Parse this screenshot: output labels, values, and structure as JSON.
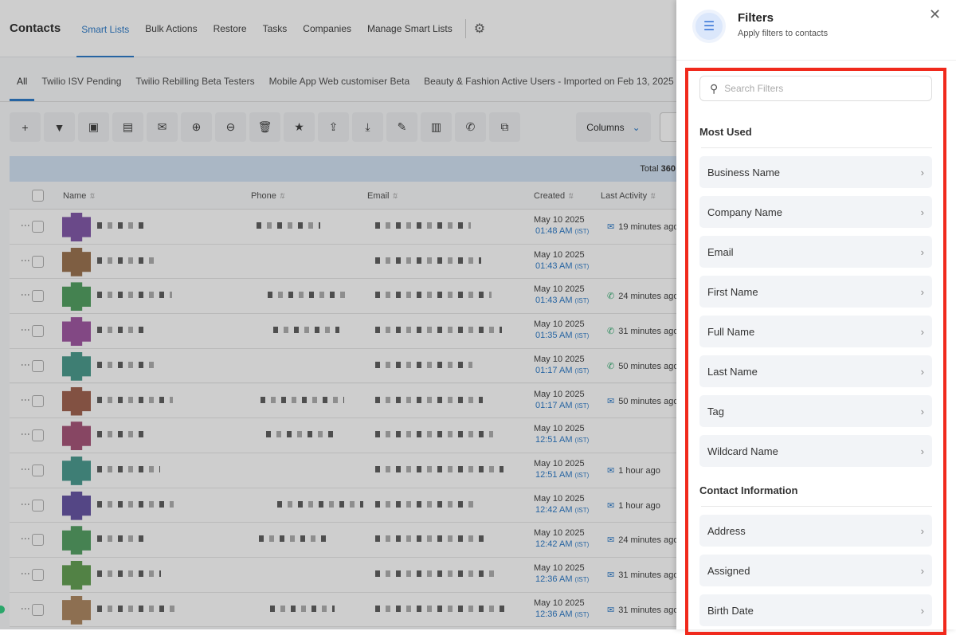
{
  "nav": {
    "title": "Contacts",
    "tabs": [
      "Smart Lists",
      "Bulk Actions",
      "Restore",
      "Tasks",
      "Companies",
      "Manage Smart Lists"
    ],
    "active_tab": 0
  },
  "smart_lists": [
    "All",
    "Twilio ISV Pending",
    "Twilio Rebilling Beta Testers",
    "Mobile App Web customiser Beta",
    "Beauty & Fashion Active Users - Imported on Feb 13, 2025"
  ],
  "toolbar": {
    "icons": [
      "plus-icon",
      "filter-icon",
      "bot-icon",
      "sms-icon",
      "email-icon",
      "add-tag-icon",
      "remove-tag-icon",
      "trash-icon",
      "star-icon",
      "export-icon",
      "import-icon",
      "review-icon",
      "company-icon",
      "whatsapp-icon",
      "merge-icon"
    ],
    "columns_label": "Columns"
  },
  "total": {
    "label": "Total",
    "value": "360"
  },
  "table": {
    "headers": [
      "Name",
      "Phone",
      "Email",
      "Created",
      "Last Activity"
    ],
    "rows": [
      {
        "date": "May 10 2025",
        "time": "01:48 AM",
        "tz": "(IST)",
        "activity_icon": "email",
        "activity": "19 minutes ago",
        "color": "#7a4ea3"
      },
      {
        "date": "May 10 2025",
        "time": "01:43 AM",
        "tz": "(IST)",
        "activity_icon": "",
        "activity": "",
        "color": "#946a45"
      },
      {
        "date": "May 10 2025",
        "time": "01:43 AM",
        "tz": "(IST)",
        "activity_icon": "whatsapp",
        "activity": "24 minutes ago",
        "color": "#479a57"
      },
      {
        "date": "May 10 2025",
        "time": "01:35 AM",
        "tz": "(IST)",
        "activity_icon": "whatsapp",
        "activity": "31 minutes ago",
        "color": "#9a4d9c"
      },
      {
        "date": "May 10 2025",
        "time": "01:17 AM",
        "tz": "(IST)",
        "activity_icon": "whatsapp",
        "activity": "50 minutes ago",
        "color": "#3f9486"
      },
      {
        "date": "May 10 2025",
        "time": "01:17 AM",
        "tz": "(IST)",
        "activity_icon": "email",
        "activity": "50 minutes ago",
        "color": "#9a5844"
      },
      {
        "date": "May 10 2025",
        "time": "12:51 AM",
        "tz": "(IST)",
        "activity_icon": "",
        "activity": "",
        "color": "#a14a71"
      },
      {
        "date": "May 10 2025",
        "time": "12:51 AM",
        "tz": "(IST)",
        "activity_icon": "email",
        "activity": "1 hour ago",
        "color": "#3f9488"
      },
      {
        "date": "May 10 2025",
        "time": "12:42 AM",
        "tz": "(IST)",
        "activity_icon": "email",
        "activity": "1 hour ago",
        "color": "#5d4a9e"
      },
      {
        "date": "May 10 2025",
        "time": "12:42 AM",
        "tz": "(IST)",
        "activity_icon": "email",
        "activity": "24 minutes ago",
        "color": "#4a9a5a"
      },
      {
        "date": "May 10 2025",
        "time": "12:36 AM",
        "tz": "(IST)",
        "activity_icon": "email",
        "activity": "31 minutes ago",
        "color": "#5a9a48"
      },
      {
        "date": "May 10 2025",
        "time": "12:36 AM",
        "tz": "(IST)",
        "activity_icon": "email",
        "activity": "31 minutes ago",
        "color": "#a88058"
      }
    ]
  },
  "panel": {
    "title": "Filters",
    "subtitle": "Apply filters to contacts",
    "search_placeholder": "Search Filters",
    "sections": [
      {
        "title": "Most Used",
        "items": [
          "Business Name",
          "Company Name",
          "Email",
          "First Name",
          "Full Name",
          "Last Name",
          "Tag",
          "Wildcard Name"
        ]
      },
      {
        "title": "Contact Information",
        "items": [
          "Address",
          "Assigned",
          "Birth Date"
        ]
      }
    ]
  },
  "colors": {
    "accent": "#1f72c4",
    "highlight": "#f0291c"
  }
}
